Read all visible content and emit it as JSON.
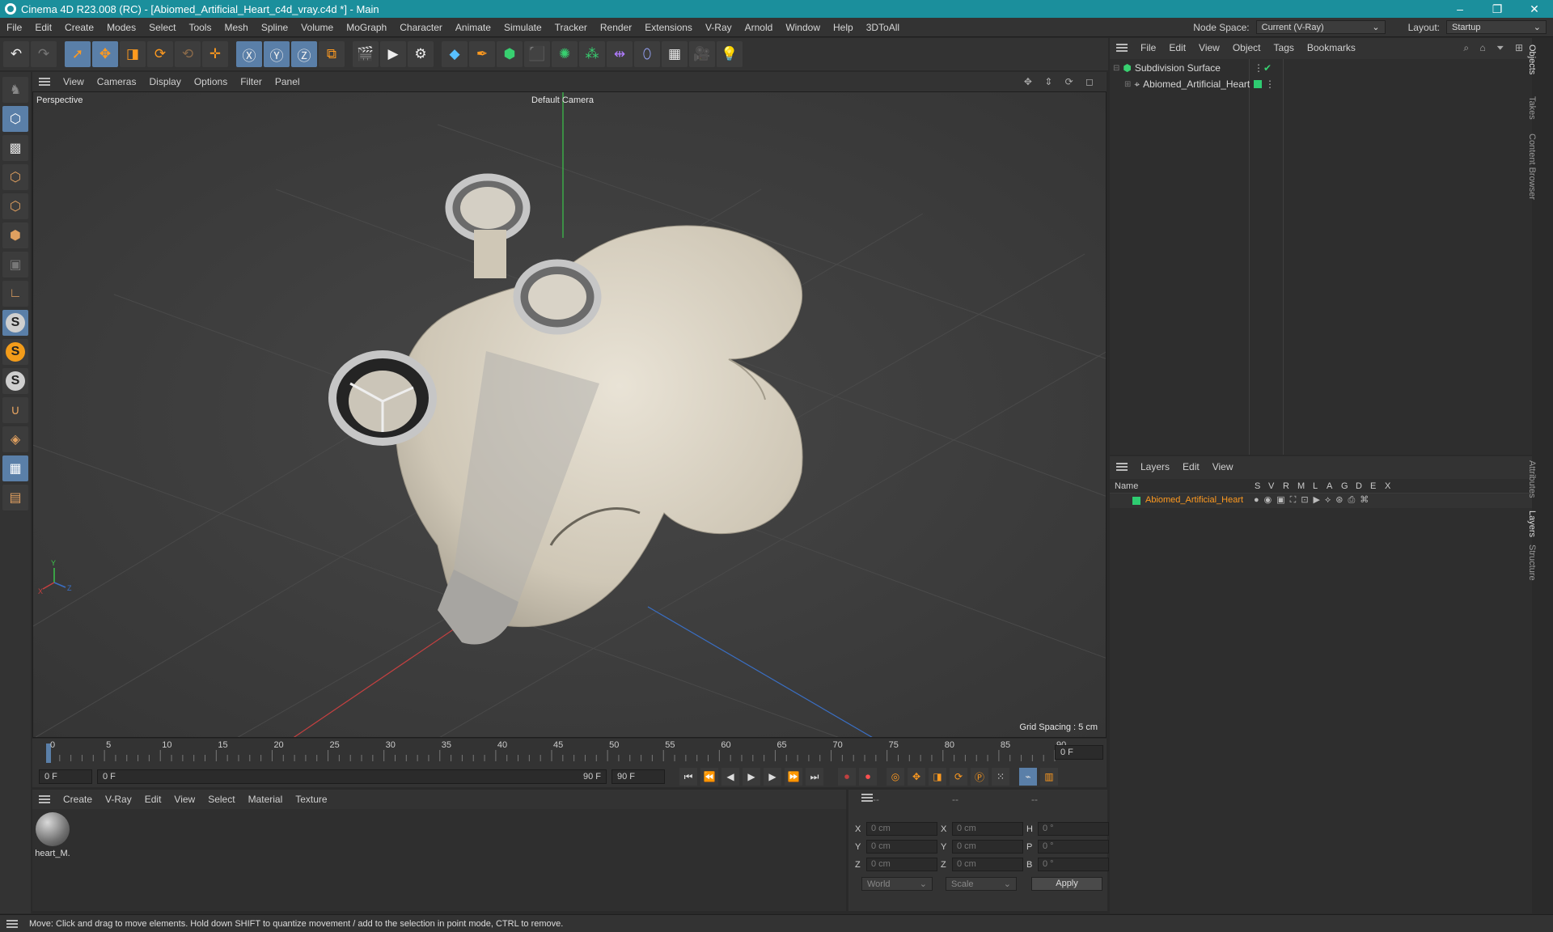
{
  "window": {
    "title": "Cinema 4D R23.008 (RC) - [Abiomed_Artificial_Heart_c4d_vray.c4d *] - Main",
    "minimize": "–",
    "maximize": "❐",
    "close": "✕"
  },
  "menubar": {
    "items": [
      "File",
      "Edit",
      "Create",
      "Modes",
      "Select",
      "Tools",
      "Mesh",
      "Spline",
      "Volume",
      "MoGraph",
      "Character",
      "Animate",
      "Simulate",
      "Tracker",
      "Render",
      "Extensions",
      "V-Ray",
      "Arnold",
      "Window",
      "Help",
      "3DToAll"
    ],
    "node_space_label": "Node Space:",
    "node_space_value": "Current (V-Ray)",
    "layout_label": "Layout:",
    "layout_value": "Startup"
  },
  "viewport": {
    "menu": [
      "View",
      "Cameras",
      "Display",
      "Options",
      "Filter",
      "Panel"
    ],
    "name": "Perspective",
    "camera": "Default Camera",
    "grid_spacing": "Grid Spacing : 5 cm",
    "axis_x": "X",
    "axis_y": "Y",
    "axis_z": "Z"
  },
  "timeline": {
    "ticks": [
      "0",
      "5",
      "10",
      "15",
      "20",
      "25",
      "30",
      "35",
      "40",
      "45",
      "50",
      "55",
      "60",
      "65",
      "70",
      "75",
      "80",
      "85",
      "90"
    ],
    "current_frame_right": "0 F",
    "start_field": "0 F",
    "range_start": "0 F",
    "range_end": "90 F",
    "end_field": "90 F",
    "current_frame": 0,
    "max_frame": 90
  },
  "material_manager": {
    "menu": [
      "Create",
      "V-Ray",
      "Edit",
      "View",
      "Select",
      "Material",
      "Texture"
    ],
    "materials": [
      {
        "name": "heart_M."
      }
    ]
  },
  "coordinates": {
    "header": [
      "--",
      "--",
      "--"
    ],
    "rows": [
      {
        "l1": "X",
        "v1": "0 cm",
        "l2": "X",
        "v2": "0 cm",
        "l3": "H",
        "v3": "0 °"
      },
      {
        "l1": "Y",
        "v1": "0 cm",
        "l2": "Y",
        "v2": "0 cm",
        "l3": "P",
        "v3": "0 °"
      },
      {
        "l1": "Z",
        "v1": "0 cm",
        "l2": "Z",
        "v2": "0 cm",
        "l3": "B",
        "v3": "0 °"
      }
    ],
    "mode1": "World",
    "mode2": "Scale",
    "apply": "Apply"
  },
  "objects": {
    "menu": [
      "File",
      "Edit",
      "View",
      "Object",
      "Tags",
      "Bookmarks"
    ],
    "items": [
      {
        "name": "Subdivision Surface"
      },
      {
        "name": "Abiomed_Artificial_Heart"
      }
    ]
  },
  "layers": {
    "menu": [
      "Layers",
      "Edit",
      "View"
    ],
    "columns": [
      "Name",
      "S",
      "V",
      "R",
      "M",
      "L",
      "A",
      "G",
      "D",
      "E",
      "X"
    ],
    "items": [
      {
        "name": "Abiomed_Artificial_Heart",
        "color": "#2ecc71"
      }
    ]
  },
  "side_tabs": [
    "Objects",
    "Takes",
    "Content Browser",
    "Attributes",
    "Layers",
    "Structure"
  ],
  "status": "Move: Click and drag to move elements. Hold down SHIFT to quantize movement / add to the selection in point mode, CTRL to remove.",
  "colors": {
    "titlebar": "#1b8f9c",
    "accent_orange": "#ff9a1f",
    "layer_green": "#2ecc71",
    "selection_blue": "#5a7fa8"
  }
}
